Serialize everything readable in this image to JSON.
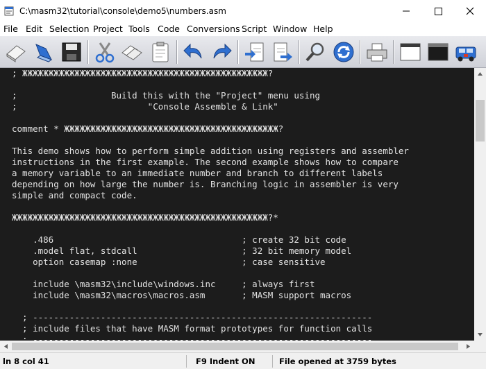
{
  "window": {
    "title": "C:\\masm32\\tutorial\\console\\demo5\\numbers.asm"
  },
  "menu": [
    "File",
    "Edit",
    "Selection",
    "Project",
    "Tools",
    "Code",
    "Conversions",
    "Script",
    "Window",
    "Help"
  ],
  "toolbar": {
    "icons": [
      "new-file-icon",
      "open-file-icon",
      "save-icon",
      "cut-icon",
      "copy-icon",
      "paste-icon",
      "undo-icon",
      "redo-icon",
      "import-icon",
      "export-icon",
      "find-icon",
      "refresh-icon",
      "print-icon",
      "window-icon",
      "console-icon",
      "run-icon"
    ]
  },
  "editor": {
    "lines": [
      "; ЖЖЖЖЖЖЖЖЖЖЖЖЖЖЖЖЖЖЖЖЖЖЖЖЖЖЖЖЖЖЖЖЖЖЖЖЖЖЖЖЖЖЖЖЖЖЖ?",
      "",
      ";                  Build this with the \"Project\" menu using",
      ";                         \"Console Assemble & Link\"",
      "",
      "comment * ЖЖЖЖЖЖЖЖЖЖЖЖЖЖЖЖЖЖЖЖЖЖЖЖЖЖЖЖЖЖЖЖЖЖЖЖЖЖЖЖЖ?",
      "",
      "This demo shows how to perform simple addition using registers and assembler",
      "instructions in the first example. The second example shows how to compare",
      "a memory variable to an immediate number and branch to different labels",
      "depending on how large the number is. Branching logic in assembler is very",
      "simple and compact code.",
      "",
      "ЖЖЖЖЖЖЖЖЖЖЖЖЖЖЖЖЖЖЖЖЖЖЖЖЖЖЖЖЖЖЖЖЖЖЖЖЖЖЖЖЖЖЖЖЖЖЖЖЖ?*",
      "",
      "    .486                                    ; create 32 bit code",
      "    .model flat, stdcall                    ; 32 bit memory model",
      "    option casemap :none                    ; case sensitive",
      "",
      "    include \\masm32\\include\\windows.inc     ; always first",
      "    include \\masm32\\macros\\macros.asm       ; MASM support macros",
      "",
      "  ; -----------------------------------------------------------------",
      "  ; include files that have MASM format prototypes for function calls",
      "  ; -----------------------------------------------------------------"
    ]
  },
  "statusbar": {
    "position": "ln 8 col 41",
    "indent": "F9 Indent ON",
    "message": "File opened at 3759 bytes"
  },
  "colors": {
    "editor_bg": "#1c1c1c",
    "editor_text": "#e2e2e2",
    "toolbar_accent": "#2f6fd0"
  }
}
